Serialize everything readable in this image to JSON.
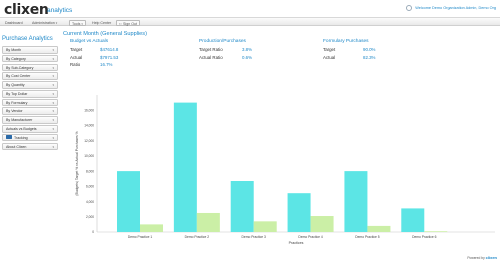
{
  "header": {
    "logo_text": "clixen",
    "logo_sub": "analytics",
    "welcome": "Welcome Demo Organization Admin, Demo Org"
  },
  "nav": {
    "items": [
      {
        "label": "Dashboard",
        "button": false
      },
      {
        "label": "Administration",
        "button": false,
        "caret": true
      },
      {
        "label": "Tools",
        "button": true,
        "caret": true
      },
      {
        "label": "Help Center",
        "button": false
      },
      {
        "label": "Sign Out",
        "button": true
      }
    ]
  },
  "sidebar": {
    "title": "Purchase Analytics",
    "items": [
      {
        "label": "By Month"
      },
      {
        "label": "By Category"
      },
      {
        "label": "By Sub-Category"
      },
      {
        "label": "By Cost Center"
      },
      {
        "label": "By Quantity"
      },
      {
        "label": "By Top Dollar"
      },
      {
        "label": "By Formulary"
      },
      {
        "label": "By Vendor"
      },
      {
        "label": "By Manufacturer"
      },
      {
        "label": "Actuals vs Budgets"
      },
      {
        "label": "Tracking",
        "icon": true
      },
      {
        "label": "About Clixen"
      }
    ]
  },
  "main": {
    "title": "Current Month (General Supplies)",
    "budget": {
      "heading": "Budget vs Actuals",
      "rows": [
        {
          "label": "Target",
          "value": "$47614.8"
        },
        {
          "label": "Actual",
          "value": "$7971.53"
        },
        {
          "label": "Ratio",
          "value": "16.7%"
        }
      ]
    },
    "production": {
      "heading": "Production/Purchases",
      "rows": [
        {
          "label": "Target Ratio",
          "value": "3.8%"
        },
        {
          "label": "Actual Ratio",
          "value": "0.6%"
        }
      ]
    },
    "formulary": {
      "heading": "Formulary Purchases",
      "rows": [
        {
          "label": "Target",
          "value": "90.0%"
        },
        {
          "label": "Actual",
          "value": "82.3%"
        }
      ]
    }
  },
  "chart_data": {
    "type": "bar",
    "categories": [
      "Demo Practice 1",
      "Demo Practice 2",
      "Demo Practice 3",
      "Demo Practice 4",
      "Demo Practice 5",
      "Demo Practice 6",
      ""
    ],
    "series": [
      {
        "values": [
          8000,
          17000,
          6700,
          5100,
          8000,
          3100,
          0
        ]
      },
      {
        "values": [
          1000,
          2500,
          1400,
          2100,
          800,
          100,
          0
        ]
      }
    ],
    "colors": [
      "#5ce5e5",
      "#cbefa6"
    ],
    "ylim": [
      0,
      18000
    ],
    "yticks": [
      "0",
      "2,000",
      "4,000",
      "6,000",
      "8,000",
      "10,000",
      "12,000",
      "14,000",
      "16,000"
    ],
    "ylabel": "(Budgets) Target % vs Actual Purchases %",
    "xlabel": "Practices",
    "grid": false
  },
  "footer": {
    "powered_by": "Powered by",
    "brand": "clixen"
  }
}
